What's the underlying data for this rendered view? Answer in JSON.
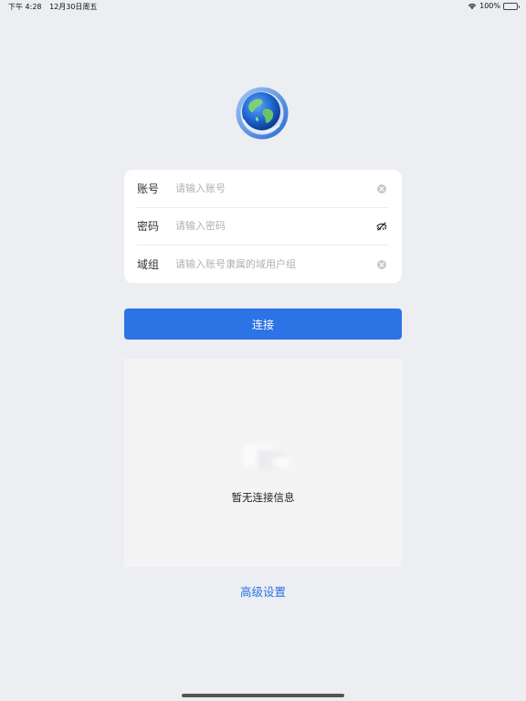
{
  "status_bar": {
    "time": "下午 4:28",
    "date": "12月30日周五",
    "battery": "100%"
  },
  "form": {
    "account": {
      "label": "账号",
      "placeholder": "请输入账号",
      "value": ""
    },
    "password": {
      "label": "密码",
      "placeholder": "请输入密码",
      "value": ""
    },
    "domain": {
      "label": "域组",
      "placeholder": "请输入账号隶属的域用户组",
      "value": ""
    }
  },
  "connect_button": {
    "label": "连接"
  },
  "empty_state": {
    "text": "暂无连接信息"
  },
  "advanced_settings": {
    "label": "高级设置"
  },
  "colors": {
    "accent": "#2c73e6",
    "background": "#eceef2",
    "panel": "#f4f4f5"
  },
  "icons": {
    "logo": "globe-icon",
    "clear": "clear-icon",
    "password_toggle": "eye-off-icon",
    "wifi": "wifi-icon",
    "battery": "battery-icon"
  }
}
